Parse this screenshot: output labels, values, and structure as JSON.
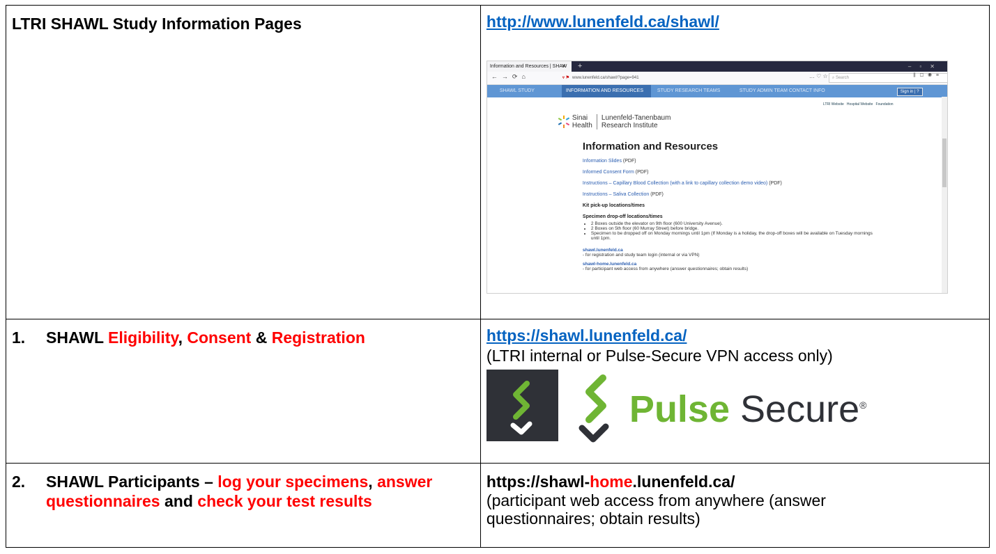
{
  "row1": {
    "left_title": "LTRI SHAWL Study Information Pages",
    "link": "http://www.lunenfeld.ca/shawl/",
    "screenshot": {
      "tab_title": "Information and Resources | SHAW",
      "url": "www.lunenfeld.ca/shawl/?page=941",
      "search_placeholder": "Search",
      "nav_items": [
        "SHAWL STUDY",
        "INFORMATION AND RESOURCES",
        "STUDY RESEARCH TEAMS",
        "STUDY ADMIN TEAM CONTACT INFO"
      ],
      "sign_in": "Sign in",
      "help": "?",
      "top_links": [
        "LTRI Website",
        "Hospital Website",
        "Foundation"
      ],
      "logo_left_1": "Sinai",
      "logo_left_2": "Health",
      "logo_right_1": "Lunenfeld-Tanenbaum",
      "logo_right_2": "Research Institute",
      "page_title": "Information and Resources",
      "links": [
        {
          "text": "Information Slides",
          "suffix": " (PDF)"
        },
        {
          "text": "Informed Consent Form",
          "suffix": " (PDF)"
        },
        {
          "text": "Instructions – Capillary Blood Collection (with a link to capillary collection demo video)",
          "suffix": " (PDF)"
        },
        {
          "text": "Instructions – Saliva Collection",
          "suffix": " (PDF)"
        }
      ],
      "kit_heading": "Kit pick-up locations/times",
      "dropoff_heading": "Specimen drop-off locations/times",
      "bullets": [
        "2 Boxes outside the elevator on 9th floor (600 University Avenue).",
        "2 Boxes on 5th floor (60 Murray Street) before bridge.",
        "Specimen to be dropped off on Monday mornings until 1pm (If Monday is a holiday, the drop-off boxes will be available on Tuesday mornings until 1pm."
      ],
      "site1": "shawl.lunenfeld.ca",
      "site1_desc": "- for registration and study team login (internal or via VPN)",
      "site2": "shawl-home.lunenfeld.ca",
      "site2_desc": "- for participant web access from anywhere (answer questionnaires; obtain results)"
    }
  },
  "row2": {
    "number": "1.",
    "title_start": "SHAWL ",
    "title_red1": "Eligibility",
    "title_sep1": ", ",
    "title_red2": "Consent",
    "title_sep2": " & ",
    "title_red3": "Registration",
    "link": "https://shawl.lunenfeld.ca/",
    "note": "(LTRI internal or Pulse-Secure VPN access only)",
    "logo_pulse": "Pulse",
    "logo_secure": "Secure",
    "logo_reg": "®"
  },
  "row3": {
    "number": "2.",
    "title_start": "SHAWL Participants – ",
    "title_red1": "log your specimens",
    "title_sep1": ", ",
    "title_red2": "answer questionnaires",
    "title_sep2": " and ",
    "title_red3": "check your test results",
    "url_a": "https://shawl-",
    "url_b": "home",
    "url_c": ".lunenfeld.ca/",
    "note": "(participant web access from anywhere (answer questionnaires; obtain results)"
  },
  "colors": {
    "red": "#ff0000",
    "link": "#0563c1",
    "nav": "#5f96d4",
    "pulse_green": "#6fb534"
  }
}
